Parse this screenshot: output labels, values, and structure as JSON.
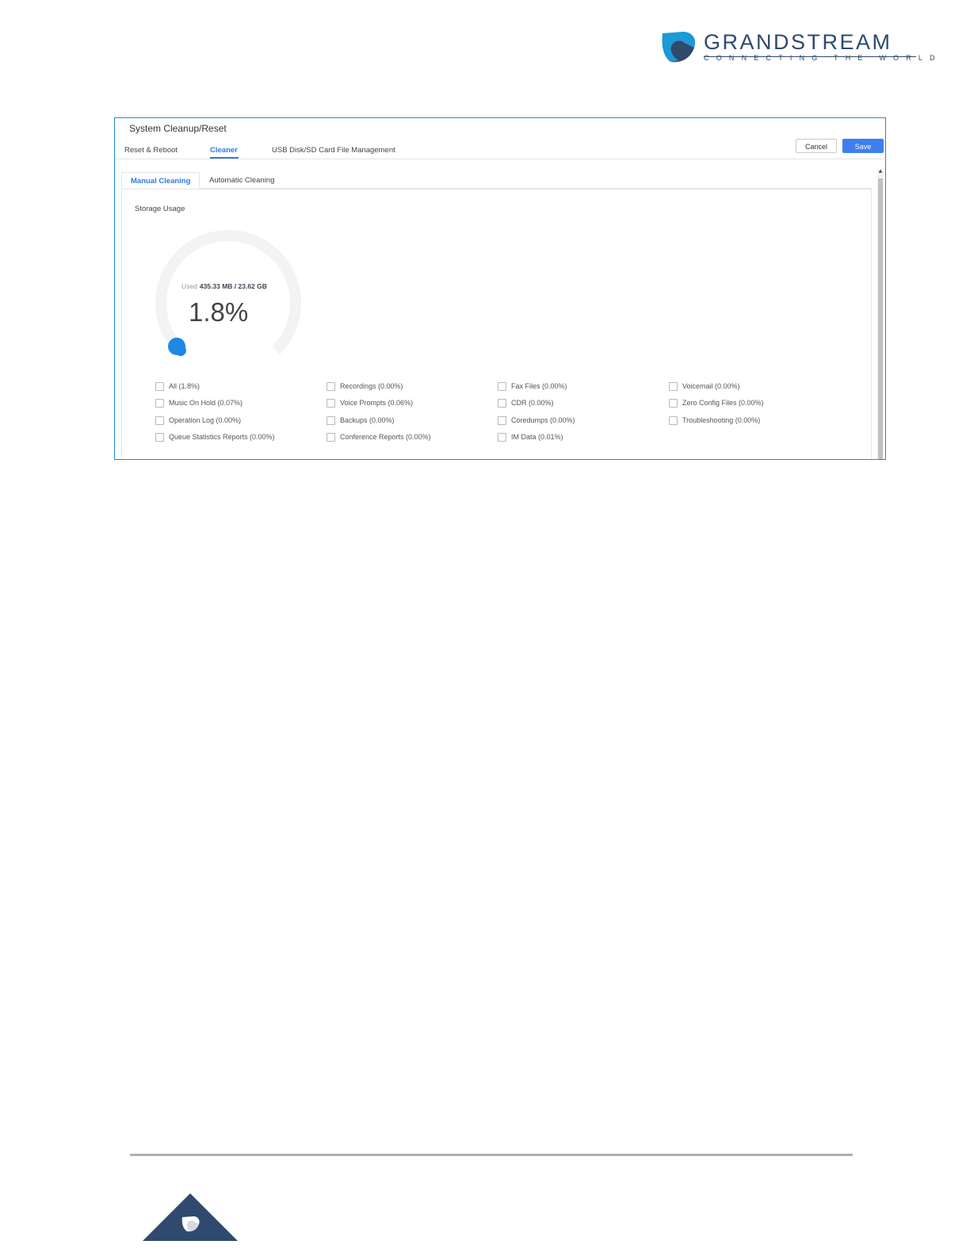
{
  "brand": {
    "name": "GRANDSTREAM",
    "tagline": "CONNECTING THE WORLD",
    "color": "#2f4a6d"
  },
  "page": {
    "title": "System Cleanup/Reset",
    "tabs": [
      {
        "label": "Reset & Reboot",
        "active": false
      },
      {
        "label": "Cleaner",
        "active": true
      },
      {
        "label": "USB Disk/SD Card File Management",
        "active": false
      }
    ],
    "buttons": {
      "cancel": "Cancel",
      "save": "Save"
    },
    "subtabs": [
      {
        "label": "Manual Cleaning",
        "active": true
      },
      {
        "label": "Automatic Cleaning",
        "active": false
      }
    ]
  },
  "storage": {
    "section_label": "Storage Usage",
    "used_label": "Used",
    "used_value": "435.33 MB / 23.62 GB",
    "percent_text": "1.8%",
    "percent_value": 1.8,
    "accent_color": "#1e88e5"
  },
  "cleanup_items": [
    [
      "All (1.8%)",
      "Recordings (0.00%)",
      "Fax Files (0.00%)",
      "Voicemail (0.00%)"
    ],
    [
      "Music On Hold (0.07%)",
      "Voice Prompts (0.06%)",
      "CDR (0.00%)",
      "Zero Config Files (0.00%)"
    ],
    [
      "Operation Log (0.00%)",
      "Backups (0.00%)",
      "Coredumps (0.00%)",
      "Troubleshooting (0.00%)"
    ],
    [
      "Queue Statistics Reports (0.00%)",
      "Conference Reports (0.00%)",
      "IM Data (0.01%)"
    ]
  ]
}
